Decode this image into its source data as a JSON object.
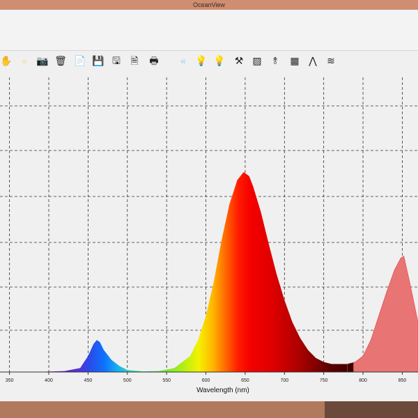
{
  "window": {
    "title": "OceanView"
  },
  "toolbar": {
    "icons": [
      "hand-icon",
      "fast-rewind-icon",
      "camera-icon",
      "trash-icon",
      "copy-icon",
      "save-icon",
      "save-as-icon",
      "export-icon",
      "print-icon",
      "rewind-icon",
      "lightbulb-on-icon",
      "lightbulb-off-icon",
      "tools-icon",
      "graph-icon",
      "peak-icon",
      "table-icon",
      "spectrum-icon",
      "overlay-icon"
    ]
  },
  "chart_data": {
    "type": "area",
    "xlabel": "Wavelength (nm)",
    "ylabel": "",
    "xlim": [
      345,
      870
    ],
    "ylim": [
      0,
      100
    ],
    "x_ticks": [
      350,
      400,
      450,
      500,
      550,
      600,
      650,
      700,
      750,
      800,
      850
    ],
    "grid": true,
    "series": [
      {
        "x": [
          345,
          380,
          420,
          440,
          450,
          457,
          461,
          465,
          470,
          480,
          490,
          500,
          520,
          540,
          560,
          580,
          590,
          600,
          610,
          620,
          630,
          640,
          648,
          655,
          660,
          670,
          680,
          690,
          700,
          710,
          720,
          730,
          740,
          750,
          760,
          770,
          780
        ],
        "y": [
          0,
          0,
          0.5,
          2,
          8,
          14,
          16,
          15,
          11,
          6,
          3,
          1,
          0.3,
          0.5,
          2,
          8,
          16,
          28,
          45,
          66,
          84,
          96,
          100,
          98,
          93,
          80,
          64,
          49,
          36,
          25,
          17,
          11,
          7,
          5,
          4,
          4,
          4
        ]
      },
      {
        "x": [
          780,
          790,
          800,
          810,
          820,
          830,
          840,
          848,
          852,
          860,
          870
        ],
        "y": [
          4,
          5,
          8,
          16,
          28,
          40,
          51,
          57,
          58,
          44,
          25
        ]
      }
    ]
  }
}
